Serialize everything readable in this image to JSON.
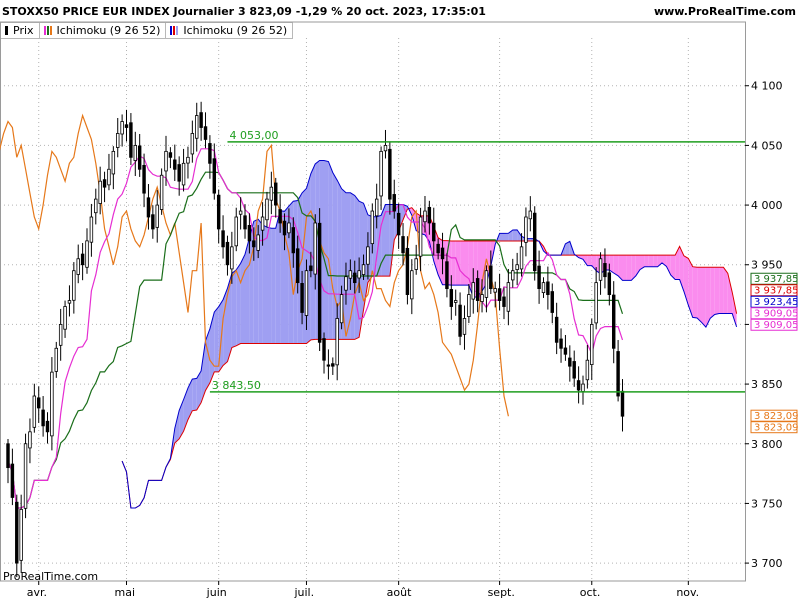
{
  "header": {
    "title": "STOXX50 PRICE EUR INDEX Journalier 3 823,09 -1,29 % 20 oct. 2023, 17:35:01",
    "site": "www.ProRealTime.com"
  },
  "legend": {
    "items": [
      {
        "label": "Prix"
      },
      {
        "label": "Ichimoku (9 26 52)"
      },
      {
        "label": "Ichimoku (9 26 52)"
      }
    ]
  },
  "watermark": "ProRealTime.com",
  "colors": {
    "candle": "#000000",
    "tenkan": "#e62ed2",
    "kijun": "#1a6e1a",
    "chikou": "#e6781a",
    "spanA": "#0000cc",
    "spanB": "#dd0000",
    "cloud_bull": "#9f9ff2",
    "cloud_bear": "#fa8cee",
    "levels": "#1f9e1f",
    "grid": "#b4b4b4"
  },
  "chart_data": {
    "type": "candlestick",
    "ylim": [
      3685,
      4140
    ],
    "yticks": [
      {
        "value": 3700,
        "label": "3 700"
      },
      {
        "value": 3750,
        "label": "3 750"
      },
      {
        "value": 3800,
        "label": "3 800"
      },
      {
        "value": 3850,
        "label": "3 850"
      },
      {
        "value": 3900,
        "label": "3 900"
      },
      {
        "value": 3950,
        "label": "3 950"
      },
      {
        "value": 4000,
        "label": "4 000"
      },
      {
        "value": 4050,
        "label": "4 050"
      },
      {
        "value": 4100,
        "label": "4 100"
      }
    ],
    "xticks": [
      {
        "label": "avr.",
        "index": 7
      },
      {
        "label": "mai",
        "index": 27
      },
      {
        "label": "juin",
        "index": 48
      },
      {
        "label": "juil.",
        "index": 68
      },
      {
        "label": "août",
        "index": 89
      },
      {
        "label": "sept.",
        "index": 112
      },
      {
        "label": "oct.",
        "index": 133
      },
      {
        "label": "nov.",
        "index": 155
      }
    ],
    "levels": [
      {
        "value": 4053,
        "label": "4 053,00",
        "from_index": 50
      },
      {
        "value": 3843.5,
        "label": "3 843,50",
        "from_index": 46
      }
    ],
    "last_values": [
      {
        "value": 3937.85,
        "label": "3 937,85",
        "color": "#1a6e1a"
      },
      {
        "value": 3937.85,
        "label": "3 937,85",
        "color": "#dd0000"
      },
      {
        "value": 3923.45,
        "label": "3 923,45",
        "color": "#0000cc"
      },
      {
        "value": 3909.05,
        "label": "3 909,05",
        "color": "#e62ed2"
      },
      {
        "value": 3909.05,
        "label": "3 909,05",
        "color": "#e62ed2"
      },
      {
        "value": 3823.09,
        "label": "3 823,09",
        "color": "#e6781a"
      },
      {
        "value": 3823.09,
        "label": "3 823,09",
        "color": "#e6781a"
      }
    ],
    "close": [
      3780,
      3755,
      3700,
      3745,
      3800,
      3810,
      3840,
      3830,
      3815,
      3810,
      3860,
      3880,
      3900,
      3915,
      3920,
      3945,
      3955,
      3950,
      3970,
      3990,
      4005,
      4020,
      4015,
      4030,
      4045,
      4060,
      4070,
      4065,
      4040,
      4050,
      4030,
      4010,
      3990,
      3980,
      4000,
      4025,
      4045,
      4040,
      4030,
      4020,
      4035,
      4040,
      4060,
      4075,
      4065,
      4055,
      4035,
      4010,
      3980,
      3965,
      3950,
      3965,
      3990,
      3995,
      3980,
      3970,
      3965,
      3975,
      3990,
      4005,
      4015,
      4000,
      3985,
      3975,
      3985,
      3960,
      3935,
      3910,
      3945,
      3945,
      3985,
      3885,
      3870,
      3865,
      3865,
      3905,
      3925,
      3940,
      3945,
      3935,
      3945,
      3950,
      3965,
      3995,
      4005,
      4045,
      4050,
      4005,
      3995,
      3975,
      3960,
      3925,
      3945,
      3955,
      3990,
      3995,
      3985,
      3970,
      3960,
      3955,
      3930,
      3915,
      3920,
      3890,
      3905,
      3925,
      3935,
      3920,
      3925,
      3945,
      3930,
      3930,
      3920,
      3915,
      3935,
      3945,
      3950,
      3965,
      3990,
      3995,
      3945,
      3930,
      3935,
      3925,
      3910,
      3885,
      3880,
      3875,
      3865,
      3855,
      3845,
      3850,
      3870,
      3900,
      3935,
      3955,
      3940,
      3925,
      3880,
      3840,
      3823.09
    ]
  }
}
